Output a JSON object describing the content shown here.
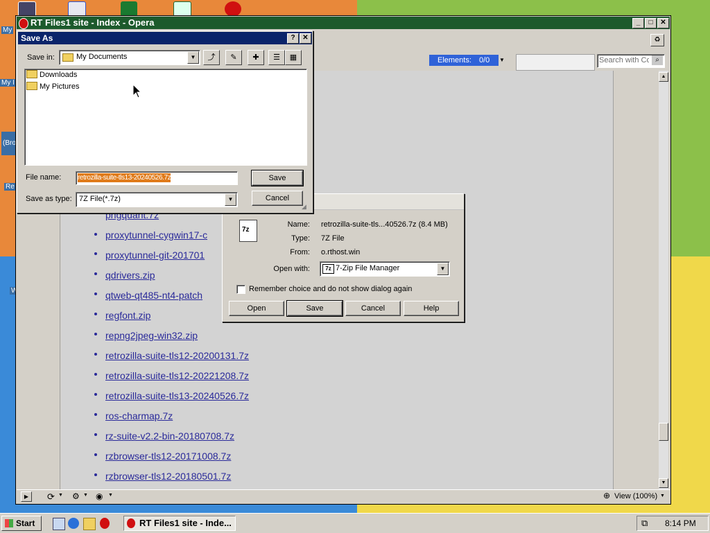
{
  "desktop": {
    "labels": [
      "My",
      "My I",
      "(Bro",
      "Re",
      "W"
    ]
  },
  "opera": {
    "title": "RT Files1 site - Index - Opera",
    "elements_label": "Elements:",
    "elements_count": "0/0",
    "search_placeholder": "Search with Co",
    "zoom": "View (100%)",
    "links": [
      "pngquant.7z",
      "proxytunnel-cygwin17-c",
      "proxytunnel-git-201701",
      "qdrivers.zip",
      "qtweb-qt485-nt4-patch",
      "regfont.zip",
      "repng2jpeg-win32.zip",
      "retrozilla-suite-tls12-20200131.7z",
      "retrozilla-suite-tls12-20221208.7z",
      "retrozilla-suite-tls13-20240526.7z",
      "ros-charmap.7z",
      "rz-suite-v2.2-bin-20180708.7z",
      "rzbrowser-tls12-20171008.7z",
      "rzbrowser-tls12-20180501.7z"
    ]
  },
  "saveas": {
    "title": "Save As",
    "help_btn": "?",
    "close_btn": "✕",
    "save_in_label": "Save in:",
    "save_in_value": "My Documents",
    "folders": [
      "Downloads",
      "My Pictures"
    ],
    "filename_label": "File name:",
    "filename_value": "retrozilla-suite-tls13-20240526.7z",
    "type_label": "Save as type:",
    "type_value": "7Z File(*.7z)",
    "save_btn": "Save",
    "cancel_btn": "Cancel"
  },
  "download": {
    "icon_text": "7z",
    "name_label": "Name:",
    "name_value": "retrozilla-suite-tls...40526.7z (8.4 MB)",
    "type_label": "Type:",
    "type_value": "7Z File",
    "from_label": "From:",
    "from_value": "o.rthost.win",
    "openwith_label": "Open with:",
    "openwith_value": "7-Zip File Manager",
    "openwith_icon": "7z",
    "remember_label": "Remember choice and do not show dialog again",
    "buttons": [
      "Open",
      "Save",
      "Cancel",
      "Help"
    ]
  },
  "taskbar": {
    "start": "Start",
    "task": "RT Files1 site - Inde...",
    "time": "8:14 PM"
  },
  "colors": {
    "opera_title": "#1c5a2c",
    "elements_bar": "#2f62d8",
    "filename_highlight": "#e07b1a",
    "link": "#2a2a9a"
  }
}
